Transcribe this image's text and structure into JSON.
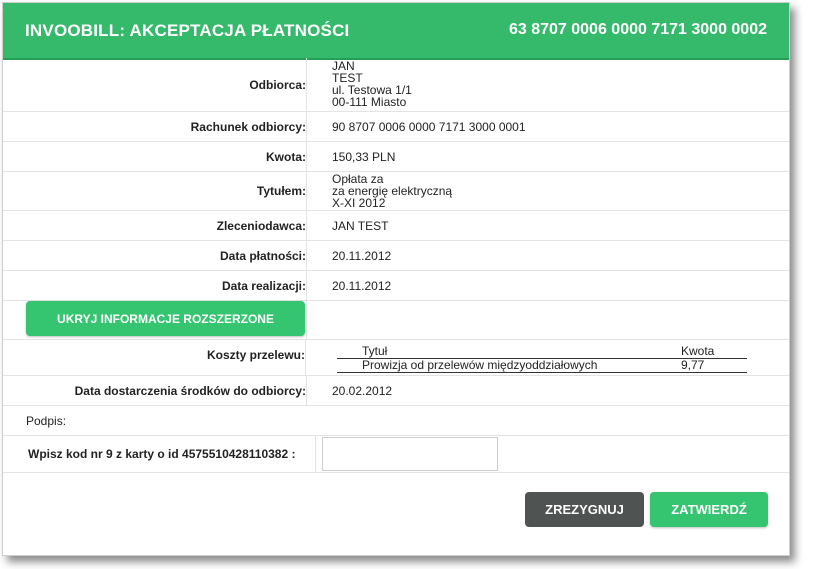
{
  "header": {
    "title": "INVOOBILL: AKCEPTACJA PŁATNOŚCI",
    "account": "63 8707 0006 0000 7171 3000 0002"
  },
  "details": {
    "recipient_label": "Odbiorca:",
    "recipient_lines": [
      "JAN",
      "TEST",
      "ul. Testowa 1/1",
      "00-111 Miasto"
    ],
    "recipient_account_label": "Rachunek odbiorcy:",
    "recipient_account": "90 8707 0006 0000 7171 3000 0001",
    "amount_label": "Kwota:",
    "amount": "150,33 PLN",
    "title_label": "Tytułem:",
    "title_lines": [
      "Opłata za",
      "za energię elektryczną",
      "X-XI 2012"
    ],
    "orderer_label": "Zleceniodawca:",
    "orderer": "JAN TEST",
    "payment_date_label": "Data płatności:",
    "payment_date": "20.11.2012",
    "realization_date_label": "Data realizacji:",
    "realization_date": "20.11.2012"
  },
  "extended": {
    "hide_button_label": "UKRYJ INFORMACJE ROZSZERZONE",
    "costs_label": "Koszty przelewu:",
    "costs_table": {
      "headers": [
        "Tytuł",
        "Kwota"
      ],
      "rows": [
        [
          "Prowizja od przelewów międzyoddziałowych",
          "9,77"
        ]
      ]
    },
    "delivery_label": "Data dostarczenia środków do odbiorcy:",
    "delivery_date": "20.02.2012"
  },
  "signature": {
    "label": "Podpis:",
    "code_label": "Wpisz kod nr 9 z karty o id 4575510428110382 :",
    "code_value": ""
  },
  "actions": {
    "cancel_label": "ZREZYGNUJ",
    "confirm_label": "ZATWIERDŹ"
  },
  "colors": {
    "header_bg": "#35b96a",
    "confirm_bg": "#35c46f",
    "cancel_bg": "#4f5352"
  }
}
